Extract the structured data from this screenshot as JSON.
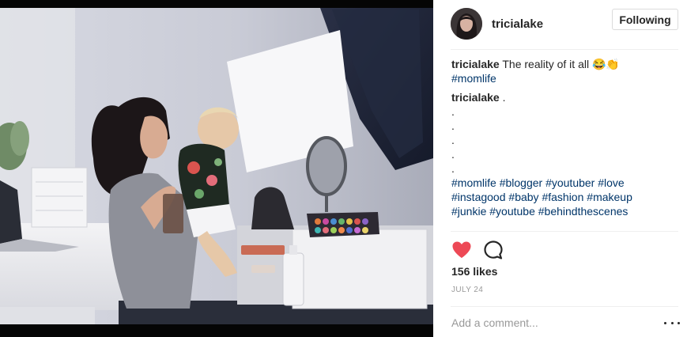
{
  "post": {
    "image_icon": "photo-mom-with-baby-makeup-setup",
    "author": {
      "username": "tricialake",
      "avatar_icon": "profile-avatar"
    },
    "follow_button_label": "Following",
    "caption": {
      "username": "tricialake",
      "text": "The reality of it all",
      "emoji": "😂👏",
      "hashtag": "#momlife"
    },
    "comment": {
      "username": "tricialake",
      "text": ".",
      "dots": [
        ".",
        ".",
        ".",
        ".",
        "."
      ],
      "hashtags": [
        "#momlife",
        "#blogger",
        "#youtuber",
        "#love",
        "#instagood",
        "#baby",
        "#fashion",
        "#makeup",
        "#junkie",
        "#youtube",
        "#behindthescenes"
      ]
    },
    "actions": {
      "like_icon": "heart-filled-icon",
      "comment_icon": "comment-bubble-icon",
      "liked": true
    },
    "likes_text": "156 likes",
    "date": "JULY 24",
    "add_comment_placeholder": "Add a comment...",
    "more_icon": "more-options-icon",
    "colors": {
      "heart": "#ed4956",
      "hashtag": "#003569",
      "text": "#262626",
      "muted": "#999999",
      "divider": "#efefef"
    }
  }
}
